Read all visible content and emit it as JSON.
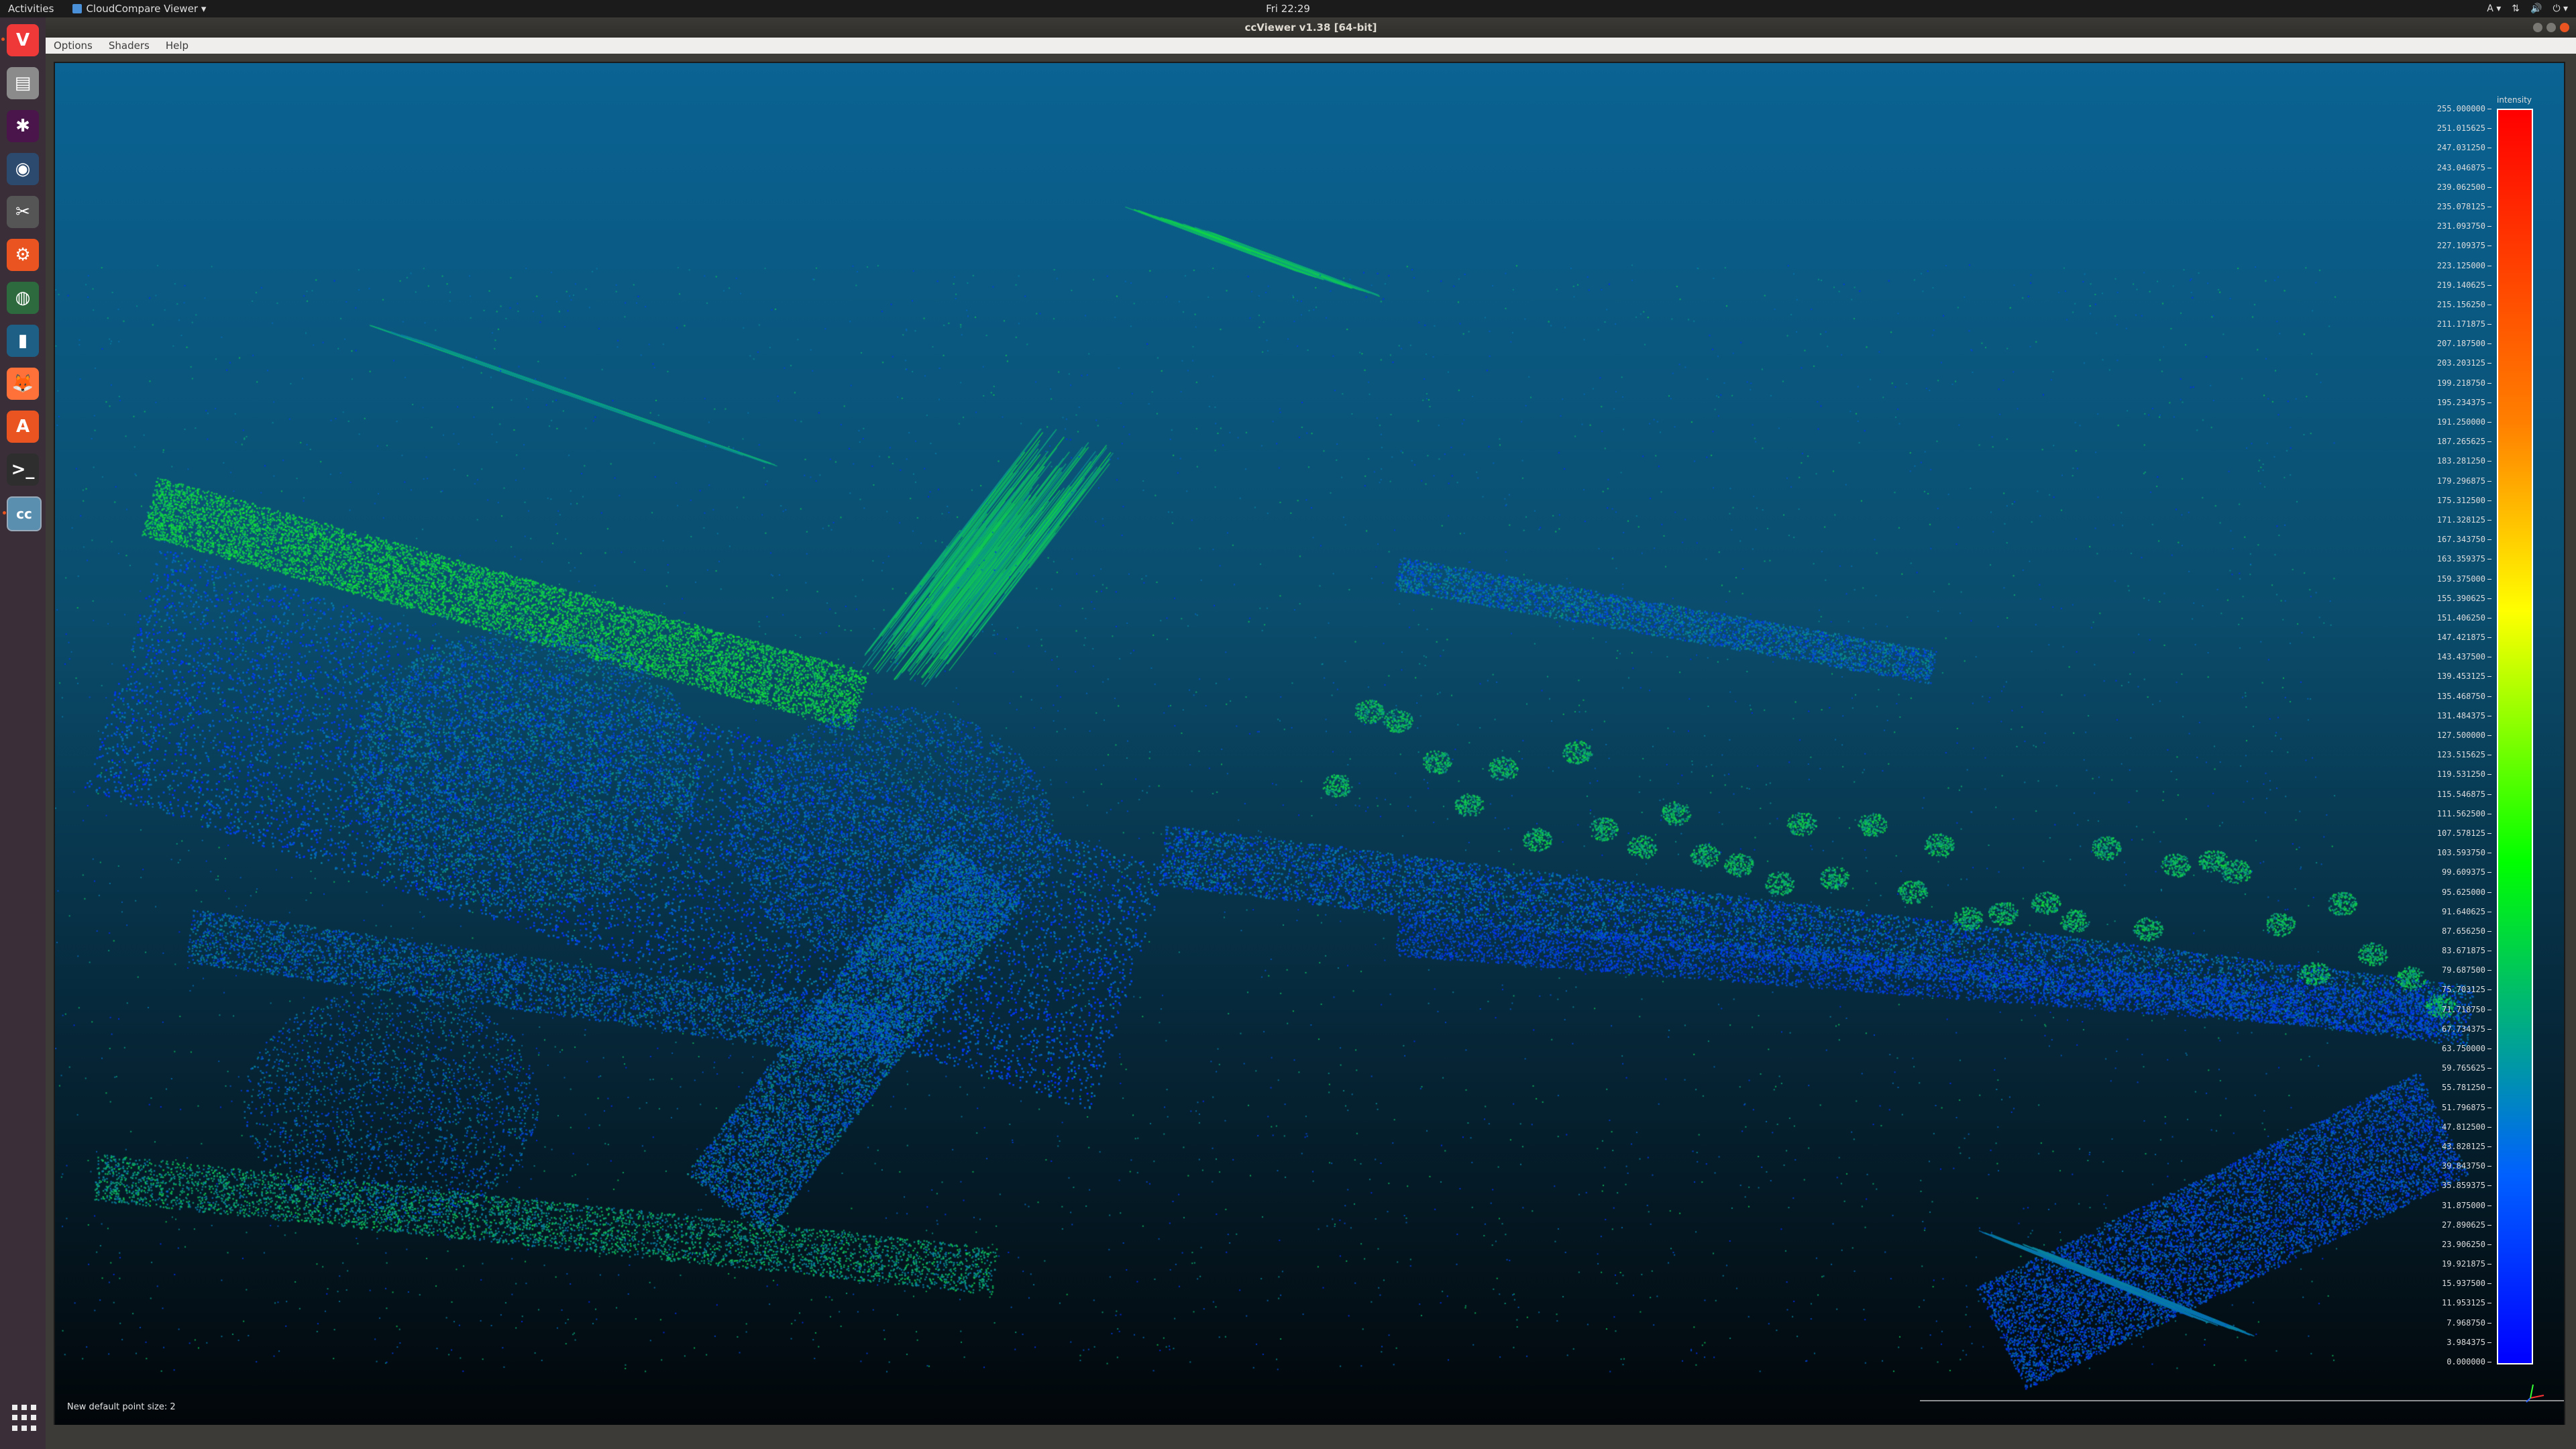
{
  "topbar": {
    "activities": "Activities",
    "app_menu": "CloudCompare Viewer ▾",
    "clock": "Fri 22:29",
    "tray": {
      "keyboard": "A ▾",
      "network": "⇅",
      "volume": "🔊",
      "power": "⏻ ▾"
    }
  },
  "window": {
    "title": "ccViewer v1.38 [64-bit]"
  },
  "menubar": {
    "items": [
      "Options",
      "Shaders",
      "Help"
    ]
  },
  "dock": {
    "items": [
      {
        "name": "vivaldi-icon",
        "glyph": "V",
        "color": "#ef3939",
        "running": true
      },
      {
        "name": "files-icon",
        "glyph": "▤",
        "color": "#8b8b8b",
        "running": false
      },
      {
        "name": "slack-icon",
        "glyph": "✱",
        "color": "#4a154b",
        "running": false
      },
      {
        "name": "disk-utility-icon",
        "glyph": "◉",
        "color": "#2c4a6e",
        "running": false
      },
      {
        "name": "screenshot-icon",
        "glyph": "✂",
        "color": "#555555",
        "running": false
      },
      {
        "name": "settings-icon",
        "glyph": "⚙",
        "color": "#e95420",
        "running": false
      },
      {
        "name": "globe-icon",
        "glyph": "◍",
        "color": "#2d6a3e",
        "running": false
      },
      {
        "name": "app-blue-icon",
        "glyph": "▮",
        "color": "#1e5f86",
        "running": false
      },
      {
        "name": "firefox-icon",
        "glyph": "🦊",
        "color": "#ff7139",
        "running": false
      },
      {
        "name": "software-center-icon",
        "glyph": "A",
        "color": "#e95420",
        "running": false
      },
      {
        "name": "terminal-icon",
        "glyph": ">_",
        "color": "#2e2e2e",
        "running": false
      },
      {
        "name": "ccviewer-icon",
        "glyph": "cc",
        "color": "#5a8fb0",
        "running": true
      }
    ]
  },
  "viewport": {
    "status_message": "New default point size: 2",
    "scalar_field": "intensity",
    "scale_min": 0,
    "scale_max": 255,
    "scale_labels": [
      "255.000000",
      "251.015625",
      "247.031250",
      "243.046875",
      "239.062500",
      "235.078125",
      "231.093750",
      "227.109375",
      "223.125000",
      "219.140625",
      "215.156250",
      "211.171875",
      "207.187500",
      "203.203125",
      "199.218750",
      "195.234375",
      "191.250000",
      "187.265625",
      "183.281250",
      "179.296875",
      "175.312500",
      "171.328125",
      "167.343750",
      "163.359375",
      "159.375000",
      "155.390625",
      "151.406250",
      "147.421875",
      "143.437500",
      "139.453125",
      "135.468750",
      "131.484375",
      "127.500000",
      "123.515625",
      "119.531250",
      "115.546875",
      "111.562500",
      "107.578125",
      "103.593750",
      "99.609375",
      "95.625000",
      "91.640625",
      "87.656250",
      "83.671875",
      "79.687500",
      "75.703125",
      "71.718750",
      "67.734375",
      "63.750000",
      "59.765625",
      "55.781250",
      "51.796875",
      "47.812500",
      "43.828125",
      "39.843750",
      "35.859375",
      "31.875000",
      "27.890625",
      "23.906250",
      "19.921875",
      "15.937500",
      "11.953125",
      "7.968750",
      "3.984375",
      "0.000000"
    ]
  }
}
